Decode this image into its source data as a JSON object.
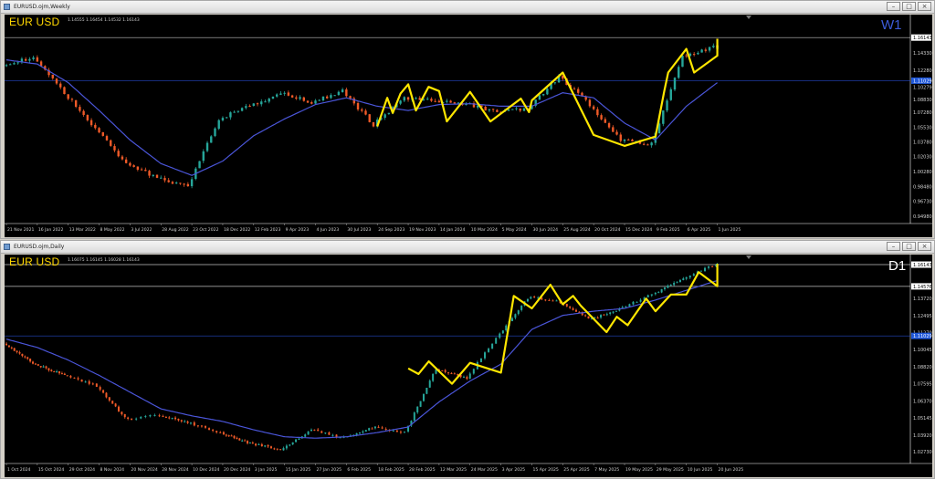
{
  "colors": {
    "bull": "#26a69a",
    "bear": "#ef5a28",
    "ma": "#4a55d8",
    "zigzag": "#ffe600",
    "grid_h": "#ffffff",
    "hline_blue": "#2a4fd8",
    "badge_blue": "#1f57d8",
    "badge_white": "#ffffff"
  },
  "icons": {
    "app": "chart-window-icon",
    "minimize": "minimize-icon",
    "maximize": "maximize-icon",
    "close": "close-icon"
  },
  "window_buttons": {
    "minimize": "–",
    "maximize": "□",
    "close": "×"
  },
  "weekly": {
    "title": "EURUSD.ojm,Weekly",
    "symbol_label": "EUR USD",
    "ohlc": "1.14555 1.16454 1.14532 1.16143",
    "timeframe": "W1",
    "yticks": [
      "1.16143",
      "1.14330",
      "1.12280",
      "1.10279",
      "1.08830",
      "1.07280",
      "1.05530",
      "1.03780",
      "1.02030",
      "1.00280",
      "0.98480",
      "0.96730",
      "0.94980"
    ],
    "badges": [
      {
        "text": "1.16143",
        "value": 1.1614,
        "style": "white"
      },
      {
        "text": "1.11029",
        "value": 1.1103,
        "style": "blue"
      }
    ],
    "xticks": [
      "21 Nov 2021",
      "16 Jan 2022",
      "13 Mar 2022",
      "8 May 2022",
      "3 Jul 2022",
      "28 Aug 2022",
      "23 Oct 2022",
      "18 Dec 2022",
      "12 Feb 2023",
      "9 Apr 2023",
      "4 Jun 2023",
      "30 Jul 2023",
      "24 Sep 2023",
      "19 Nov 2023",
      "14 Jan 2024",
      "10 Mar 2024",
      "5 May 2024",
      "30 Jun 2024",
      "25 Aug 2024",
      "20 Oct 2024",
      "15 Dec 2024",
      "9 Feb 2025",
      "6 Apr 2025",
      "1 Jun 2025"
    ]
  },
  "daily": {
    "title": "EURUSD.ojm,Daily",
    "symbol_label": "EUR USD",
    "ohlc": "1.16075 1.16145 1.16028 1.16143",
    "timeframe": "D1",
    "yticks": [
      "1.16143",
      "1.14576",
      "1.13720",
      "1.12495",
      "1.11270",
      "1.10045",
      "1.08820",
      "1.07595",
      "1.06370",
      "1.05145",
      "1.03920",
      "1.02730"
    ],
    "badges": [
      {
        "text": "1.16143",
        "value": 1.1614,
        "style": "white"
      },
      {
        "text": "1.14576",
        "value": 1.1458,
        "style": "white"
      },
      {
        "text": "1.11029",
        "value": 1.1103,
        "style": "blue"
      }
    ],
    "xticks": [
      "1 Oct 2024",
      "15 Oct 2024",
      "29 Oct 2024",
      "8 Nov 2024",
      "20 Nov 2024",
      "28 Nov 2024",
      "10 Dec 2024",
      "20 Dec 2024",
      "3 Jan 2025",
      "15 Jan 2025",
      "27 Jan 2025",
      "6 Feb 2025",
      "18 Feb 2025",
      "28 Feb 2025",
      "12 Mar 2025",
      "24 Mar 2025",
      "3 Apr 2025",
      "15 Apr 2025",
      "25 Apr 2025",
      "7 May 2025",
      "19 May 2025",
      "29 May 2025",
      "10 Jun 2025",
      "20 Jun 2025"
    ]
  },
  "chart_data": [
    {
      "type": "candlestick",
      "title": "EURUSD.ojm,Weekly",
      "ylim": [
        0.942,
        1.18
      ],
      "key_levels": [
        1.1103
      ],
      "price_path_x": [
        "21 Nov 2021",
        "16 Jan 2022",
        "13 Mar 2022",
        "8 May 2022",
        "3 Jul 2022",
        "28 Aug 2022",
        "23 Oct 2022",
        "18 Dec 2022",
        "12 Feb 2023",
        "9 Apr 2023",
        "4 Jun 2023",
        "30 Jul 2023",
        "24 Sep 2023",
        "19 Nov 2023",
        "14 Jan 2024",
        "10 Mar 2024",
        "5 May 2024",
        "30 Jun 2024",
        "25 Aug 2024",
        "20 Oct 2024",
        "15 Dec 2024",
        "9 Feb 2025",
        "6 Apr 2025",
        "1 Jun 2025"
      ],
      "price_path": [
        1.128,
        1.138,
        1.096,
        1.054,
        1.012,
        0.995,
        0.985,
        1.065,
        1.08,
        1.095,
        1.085,
        1.098,
        1.058,
        1.09,
        1.087,
        1.083,
        1.073,
        1.078,
        1.115,
        1.082,
        1.04,
        1.035,
        1.14,
        1.15
      ],
      "ma": [
        1.135,
        1.13,
        1.108,
        1.075,
        1.04,
        1.012,
        0.998,
        1.015,
        1.045,
        1.065,
        1.082,
        1.09,
        1.08,
        1.075,
        1.082,
        1.083,
        1.08,
        1.08,
        1.096,
        1.09,
        1.06,
        1.04,
        1.08,
        1.108
      ],
      "zigzag": [
        {
          "x": "24 Sep 2023",
          "y": 1.056
        },
        {
          "x": "12 Oct 2023",
          "y": 1.09
        },
        {
          "x": "22 Oct 2023",
          "y": 1.072
        },
        {
          "x": "5 Nov 2023",
          "y": 1.095
        },
        {
          "x": "19 Nov 2023",
          "y": 1.106
        },
        {
          "x": "3 Dec 2023",
          "y": 1.075
        },
        {
          "x": "26 Dec 2023",
          "y": 1.103
        },
        {
          "x": "14 Jan 2024",
          "y": 1.098
        },
        {
          "x": "28 Jan 2024",
          "y": 1.062
        },
        {
          "x": "10 Mar 2024",
          "y": 1.097
        },
        {
          "x": "16 Apr 2024",
          "y": 1.062
        },
        {
          "x": "10 Jun 2024",
          "y": 1.089
        },
        {
          "x": "25 Jun 2024",
          "y": 1.073
        },
        {
          "x": "30 Jun 2024",
          "y": 1.087
        },
        {
          "x": "25 Aug 2024",
          "y": 1.12
        },
        {
          "x": "20 Oct 2024",
          "y": 1.046
        },
        {
          "x": "15 Dec 2024",
          "y": 1.033
        },
        {
          "x": "9 Feb 2025",
          "y": 1.044
        },
        {
          "x": "25 Feb 2025",
          "y": 1.098
        },
        {
          "x": "4 Mar 2025",
          "y": 1.12
        },
        {
          "x": "6 Apr 2025",
          "y": 1.148
        },
        {
          "x": "20 Apr 2025",
          "y": 1.12
        },
        {
          "x": "1 Jun 2025",
          "y": 1.14
        },
        {
          "x": "15 Jun 2025",
          "y": 1.16
        }
      ]
    },
    {
      "type": "candlestick",
      "title": "EURUSD.ojm,Daily",
      "ylim": [
        1.0195,
        1.166
      ],
      "key_levels": [
        1.1458,
        1.1103
      ],
      "price_path_x": [
        "1 Oct 2024",
        "15 Oct 2024",
        "29 Oct 2024",
        "8 Nov 2024",
        "20 Nov 2024",
        "28 Nov 2024",
        "10 Dec 2024",
        "20 Dec 2024",
        "3 Jan 2025",
        "15 Jan 2025",
        "27 Jan 2025",
        "6 Feb 2025",
        "18 Feb 2025",
        "28 Feb 2025",
        "12 Mar 2025",
        "24 Mar 2025",
        "3 Apr 2025",
        "15 Apr 2025",
        "25 Apr 2025",
        "7 May 2025",
        "19 May 2025",
        "29 May 2025",
        "10 Jun 2025",
        "20 Jun 2025"
      ],
      "price_path": [
        1.105,
        1.09,
        1.082,
        1.075,
        1.05,
        1.054,
        1.048,
        1.041,
        1.033,
        1.029,
        1.043,
        1.037,
        1.045,
        1.041,
        1.087,
        1.08,
        1.11,
        1.138,
        1.135,
        1.122,
        1.13,
        1.14,
        1.152,
        1.161
      ],
      "ma": [
        1.108,
        1.102,
        1.093,
        1.082,
        1.07,
        1.058,
        1.053,
        1.049,
        1.043,
        1.038,
        1.037,
        1.038,
        1.041,
        1.045,
        1.063,
        1.078,
        1.09,
        1.115,
        1.125,
        1.128,
        1.13,
        1.136,
        1.143,
        1.15
      ],
      "zigzag": [
        {
          "x": "28 Feb 2025",
          "y": 1.087
        },
        {
          "x": "4 Mar 2025",
          "y": 1.083
        },
        {
          "x": "8 Mar 2025",
          "y": 1.092
        },
        {
          "x": "17 Mar 2025",
          "y": 1.076
        },
        {
          "x": "24 Mar 2025",
          "y": 1.091
        },
        {
          "x": "3 Apr 2025",
          "y": 1.084
        },
        {
          "x": "8 Apr 2025",
          "y": 1.139
        },
        {
          "x": "15 Apr 2025",
          "y": 1.13
        },
        {
          "x": "21 Apr 2025",
          "y": 1.147
        },
        {
          "x": "25 Apr 2025",
          "y": 1.133
        },
        {
          "x": "29 Apr 2025",
          "y": 1.139
        },
        {
          "x": "2 May 2025",
          "y": 1.132
        },
        {
          "x": "12 May 2025",
          "y": 1.113
        },
        {
          "x": "16 May 2025",
          "y": 1.124
        },
        {
          "x": "20 May 2025",
          "y": 1.118
        },
        {
          "x": "26 May 2025",
          "y": 1.137
        },
        {
          "x": "29 May 2025",
          "y": 1.128
        },
        {
          "x": "4 Jun 2025",
          "y": 1.14
        },
        {
          "x": "10 Jun 2025",
          "y": 1.14
        },
        {
          "x": "14 Jun 2025",
          "y": 1.156
        },
        {
          "x": "20 Jun 2025",
          "y": 1.146
        },
        {
          "x": "24 Jun 2025",
          "y": 1.162
        }
      ]
    }
  ]
}
